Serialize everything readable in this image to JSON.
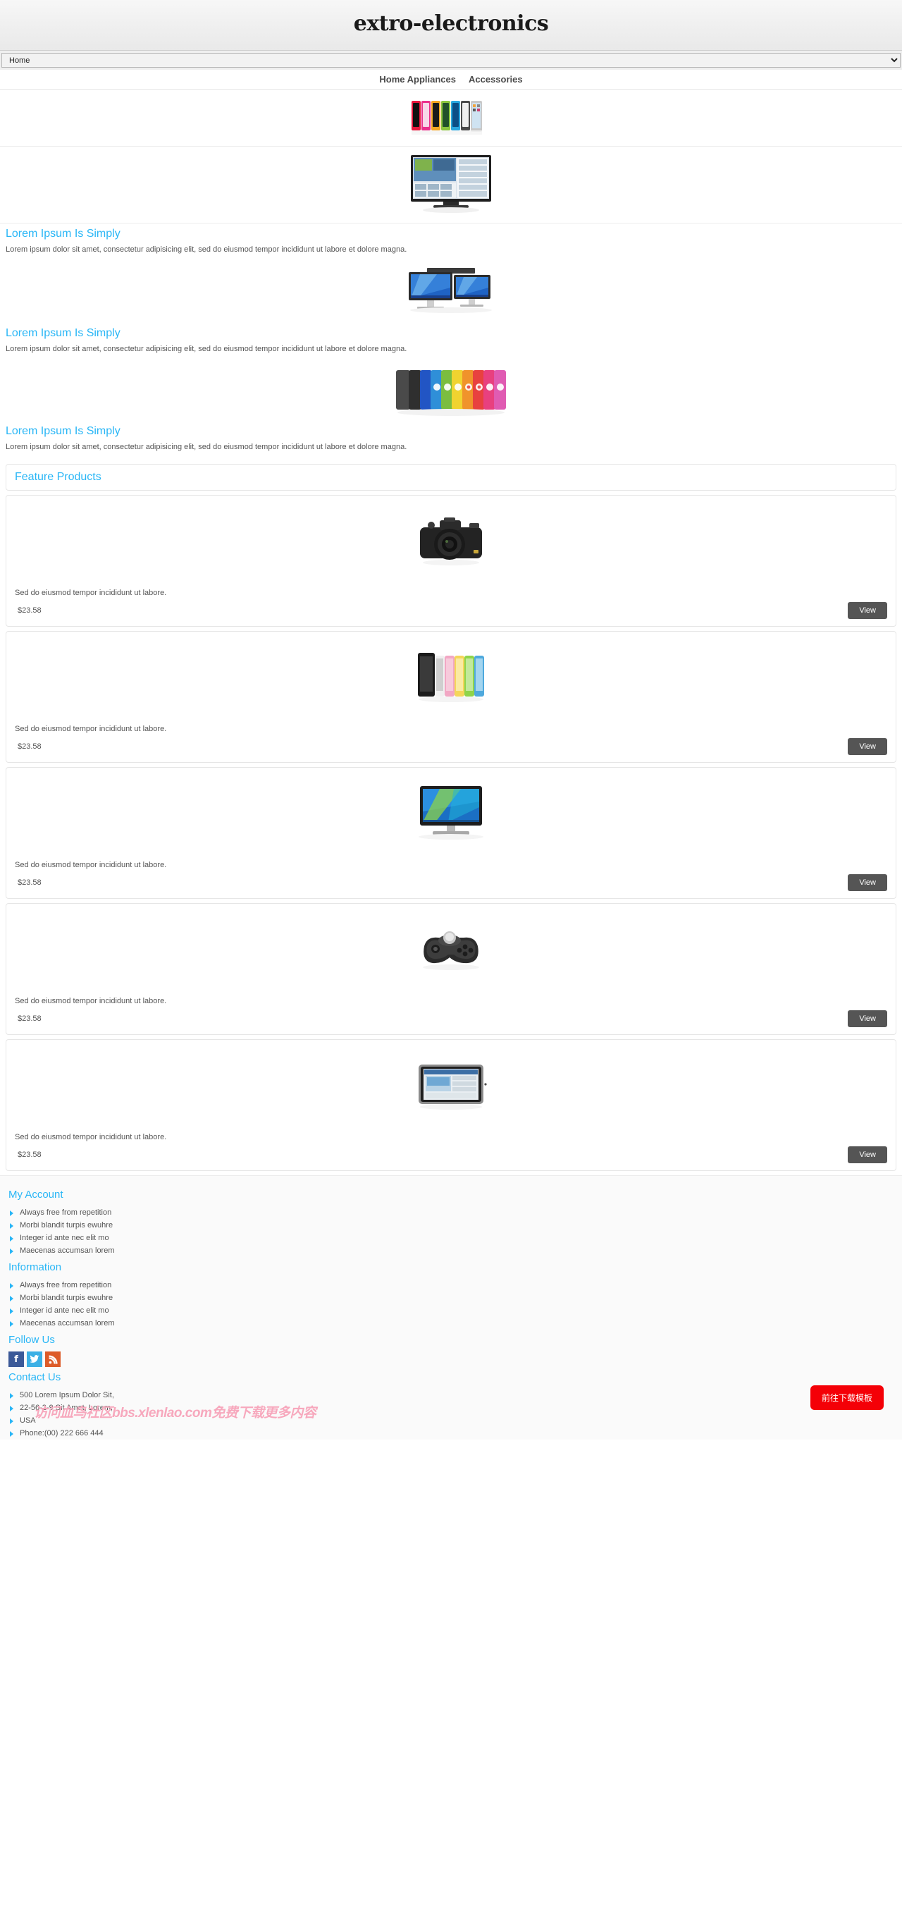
{
  "header": {
    "logo": "extro-electronics",
    "category_select": {
      "selected": "Home",
      "options": [
        "Home",
        "Home Appliances",
        "Accessories"
      ]
    },
    "nav": [
      {
        "label": "Home Appliances"
      },
      {
        "label": "Accessories"
      }
    ]
  },
  "banners": [
    {
      "name": "ipod-nano-lineup-banner",
      "alt": "Row of colorful iPod nano media players"
    },
    {
      "name": "smart-tv-banner",
      "alt": "Widescreen smart TV displaying app dashboard"
    }
  ],
  "promos": [
    {
      "title": "Lorem Ipsum Is Simply",
      "desc": "Lorem ipsum dolor sit amet, consectetur adipisicing elit, sed do eiusmod tempor incididunt ut labore et dolore magna.",
      "image_name": "imac-desktop-pair-image"
    },
    {
      "title": "Lorem Ipsum Is Simply",
      "desc": "Lorem ipsum dolor sit amet, consectetur adipisicing elit, sed do eiusmod tempor incididunt ut labore et dolore magna.",
      "image_name": "ipod-color-fan-image"
    },
    {
      "title": "Lorem Ipsum Is Simply",
      "desc": "Lorem ipsum dolor sit amet, consectetur adipisicing elit, sed do eiusmod tempor incididunt ut labore et dolore magna.",
      "image_name": "feature-lead-image"
    }
  ],
  "feature_products": {
    "heading": "Feature Products",
    "view_label": "View",
    "items": [
      {
        "image_name": "dslr-camera-image",
        "desc": "Sed do eiusmod tempor incididunt ut labore.",
        "price": "$23.58",
        "view_label": "View"
      },
      {
        "image_name": "smartphone-colors-image",
        "desc": "Sed do eiusmod tempor incididunt ut labore.",
        "price": "$23.58",
        "view_label": "View"
      },
      {
        "image_name": "monitor-display-image",
        "desc": "Sed do eiusmod tempor incididunt ut labore.",
        "price": "$23.58",
        "view_label": "View"
      },
      {
        "image_name": "game-controller-image",
        "desc": "Sed do eiusmod tempor incididunt ut labore.",
        "price": "$23.58",
        "view_label": "View"
      },
      {
        "image_name": "tablet-device-image",
        "desc": "Sed do eiusmod tempor incididunt ut labore.",
        "price": "$23.58",
        "view_label": "View"
      }
    ]
  },
  "footer": {
    "my_account": {
      "title": "My Account",
      "links": [
        "Always free from repetition",
        "Morbi blandit turpis ewuhre",
        "Integer id ante nec elit mo",
        "Maecenas accumsan lorem"
      ]
    },
    "information": {
      "title": "Information",
      "links": [
        "Always free from repetition",
        "Morbi blandit turpis ewuhre",
        "Integer id ante nec elit mo",
        "Maecenas accumsan lorem"
      ]
    },
    "follow_us": {
      "title": "Follow Us",
      "socials": [
        {
          "name": "facebook",
          "glyph": "f",
          "color": "#3b5998"
        },
        {
          "name": "twitter",
          "glyph": "⁃",
          "color": "#3cb0e5"
        },
        {
          "name": "rss",
          "glyph": "◤",
          "color": "#dd5b28"
        }
      ]
    },
    "contact_us": {
      "title": "Contact Us",
      "lines": [
        "500 Lorem Ipsum Dolor Sit,",
        "22-56-2-9 Sit Amet, Lorem,",
        "USA",
        "Phone:(00) 222 666 444"
      ]
    }
  },
  "overlay": {
    "watermark": "访问血鸟社区bbs.xlenlao.com免费下载更多内容",
    "download_button": "前往下载模板"
  }
}
